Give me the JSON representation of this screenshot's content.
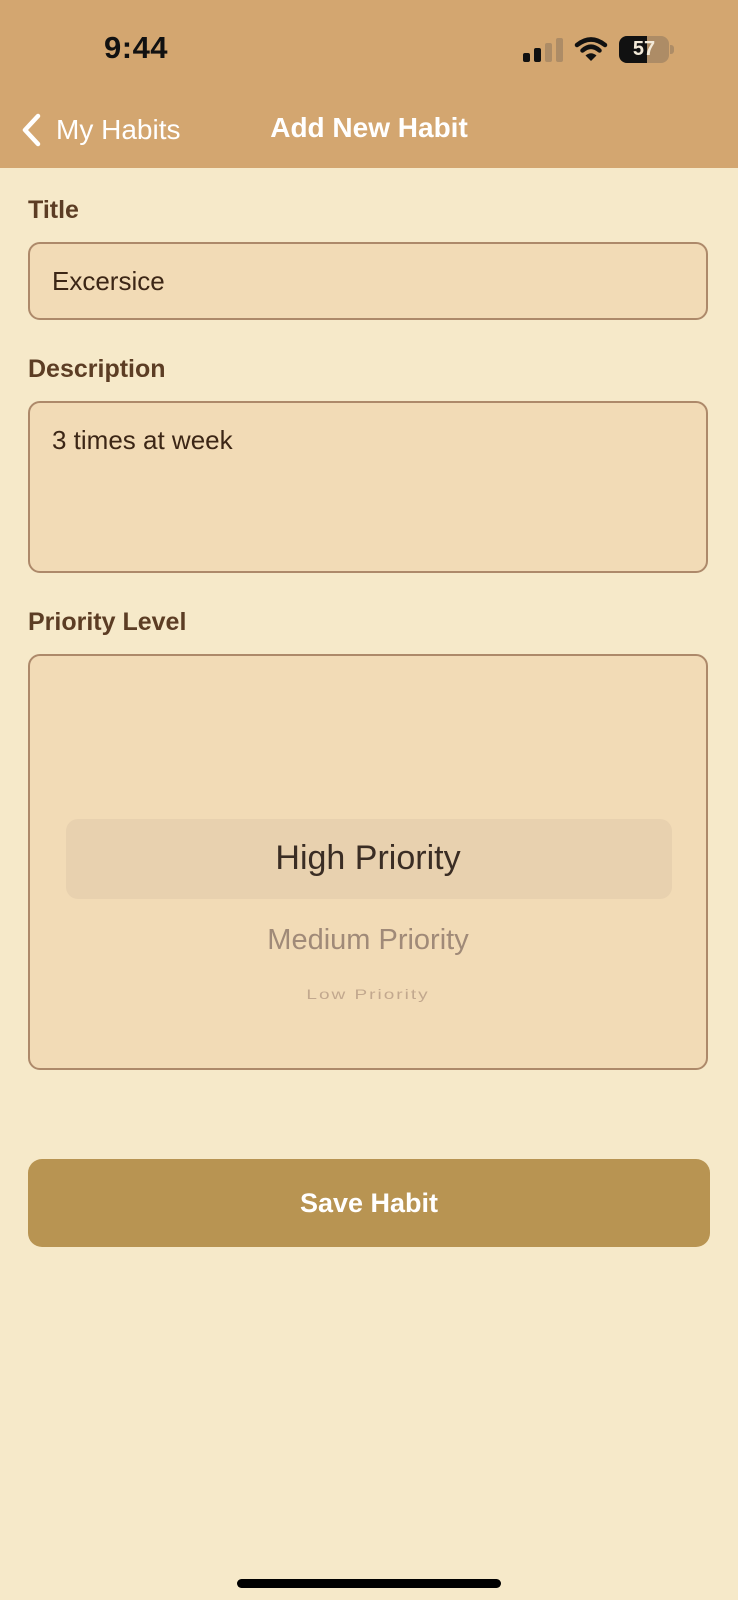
{
  "status_bar": {
    "time": "9:44",
    "battery_level": "57",
    "signal_strength_bars": 2
  },
  "nav": {
    "back_label": "My Habits",
    "title": "Add New Habit"
  },
  "form": {
    "title_label": "Title",
    "title_value": "Excersice",
    "description_label": "Description",
    "description_value": "3 times at week",
    "priority_label": "Priority Level",
    "priority_options": [
      "High Priority",
      "Medium Priority",
      "Low Priority"
    ],
    "priority_selected": "High Priority"
  },
  "actions": {
    "save_label": "Save Habit"
  },
  "colors": {
    "header": "#d3a670",
    "background": "#f6e9c9",
    "field_background": "#f2dbb6",
    "field_border": "#ad896a",
    "label_text": "#5c3d24",
    "save_button": "#b89452"
  }
}
